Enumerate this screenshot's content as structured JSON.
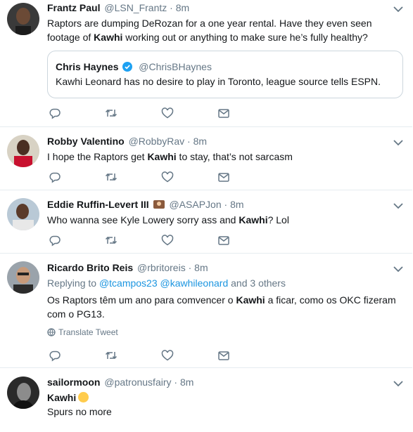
{
  "tweets": [
    {
      "name": "Frantz Paul",
      "handle": "@LSN_Frantz",
      "time": "8m",
      "text_parts": [
        "Raptors are dumping DeRozan for a one year rental. Have they even seen footage of ",
        "Kawhi",
        " working out or anything to make sure he’s fully healthy?"
      ],
      "quote": {
        "name": "Chris Haynes",
        "handle": "@ChrisBHaynes",
        "text": "Kawhi Leonard has no desire to play in Toronto, league source tells ESPN."
      }
    },
    {
      "name": "Robby Valentino",
      "handle": "@RobbyRav",
      "time": "8m",
      "text_parts": [
        "I hope the Raptors get ",
        "Kawhi",
        " to stay, that’s not sarcasm"
      ]
    },
    {
      "name": "Eddie Ruffin-Levert III",
      "handle": "@ASAPJon",
      "time": "8m",
      "text_parts": [
        "Who wanna see Kyle Lowery sorry ass and ",
        "Kawhi",
        "? Lol"
      ]
    },
    {
      "name": "Ricardo Brito Reis",
      "handle": "@rbritoreis",
      "time": "8m",
      "replying_prefix": "Replying to ",
      "replying_user1": "@tcampos23",
      "replying_user2": "@kawhileonard",
      "replying_suffix": " and 3 others",
      "text_parts": [
        "Os Raptors têm um ano para comvencer o ",
        "Kawhi",
        " a ficar, como os OKC fizeram com o PG13."
      ],
      "translate_label": "Translate Tweet"
    },
    {
      "name": "sailormoon",
      "handle": "@patronusfairy",
      "time": "8m",
      "line1": "Kawhi",
      "line2": "Spurs no more"
    }
  ],
  "dot": "·",
  "colors": {
    "link": "#1b95e0",
    "secondary": "#657786",
    "border": "#e6ecf0"
  }
}
